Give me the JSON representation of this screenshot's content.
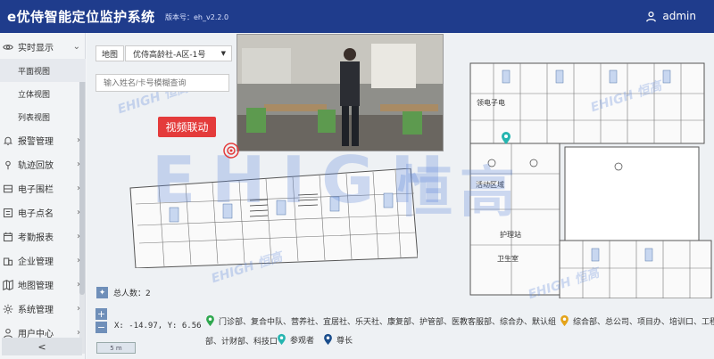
{
  "header": {
    "title": "e优侍智能定位监护系统",
    "version": "版本号：eh_v2.2.0",
    "user": "admin",
    "bg_color": "#1f3c8c"
  },
  "sidebar": {
    "realtime": {
      "label": "实时显示",
      "icon": "eye-icon"
    },
    "sub_items": [
      "平面视图",
      "立体视图",
      "列表视图"
    ],
    "items": [
      {
        "label": "报警管理",
        "icon": "bell-icon"
      },
      {
        "label": "轨迹回放",
        "icon": "track-icon"
      },
      {
        "label": "电子围栏",
        "icon": "fence-icon"
      },
      {
        "label": "电子点名",
        "icon": "rollcall-icon"
      },
      {
        "label": "考勤报表",
        "icon": "calendar-icon"
      },
      {
        "label": "企业管理",
        "icon": "company-icon"
      },
      {
        "label": "地图管理",
        "icon": "map-icon"
      },
      {
        "label": "系统管理",
        "icon": "gear-icon"
      },
      {
        "label": "用户中心",
        "icon": "user-icon"
      }
    ],
    "collapse_label": "<"
  },
  "map": {
    "map_label": "地图",
    "map_select": "优侍高龄社-A区-1号",
    "search_placeholder": "输入姓名/卡号模糊查询",
    "video_link": "视频联动",
    "total_label": "总人数：2",
    "coords": "X: -14.97, Y: 6.56",
    "scale": "5 m",
    "watermark_latin": "EHIGH",
    "watermark_cn": "恒高",
    "watermark_small": "EHIGH 恒高",
    "room_labels": [
      "活动区域",
      "护理站",
      "领电子电",
      "卫生室"
    ],
    "legend": [
      {
        "text": "门诊部、复合中队、营养社、宜居社、乐天社、康复部、护管部、医教客服部、综合办、默认组",
        "color": "#2fa84f"
      },
      {
        "text": "综合部、总公司、项目办、培训口、工程",
        "color": "#e4a319"
      },
      {
        "text": "部、计财部、科技口",
        "color": "#2fa84f"
      },
      {
        "text": "参观者",
        "color": "#25b5b0"
      },
      {
        "text": "尊长",
        "color": "#1a4d8c"
      }
    ]
  }
}
